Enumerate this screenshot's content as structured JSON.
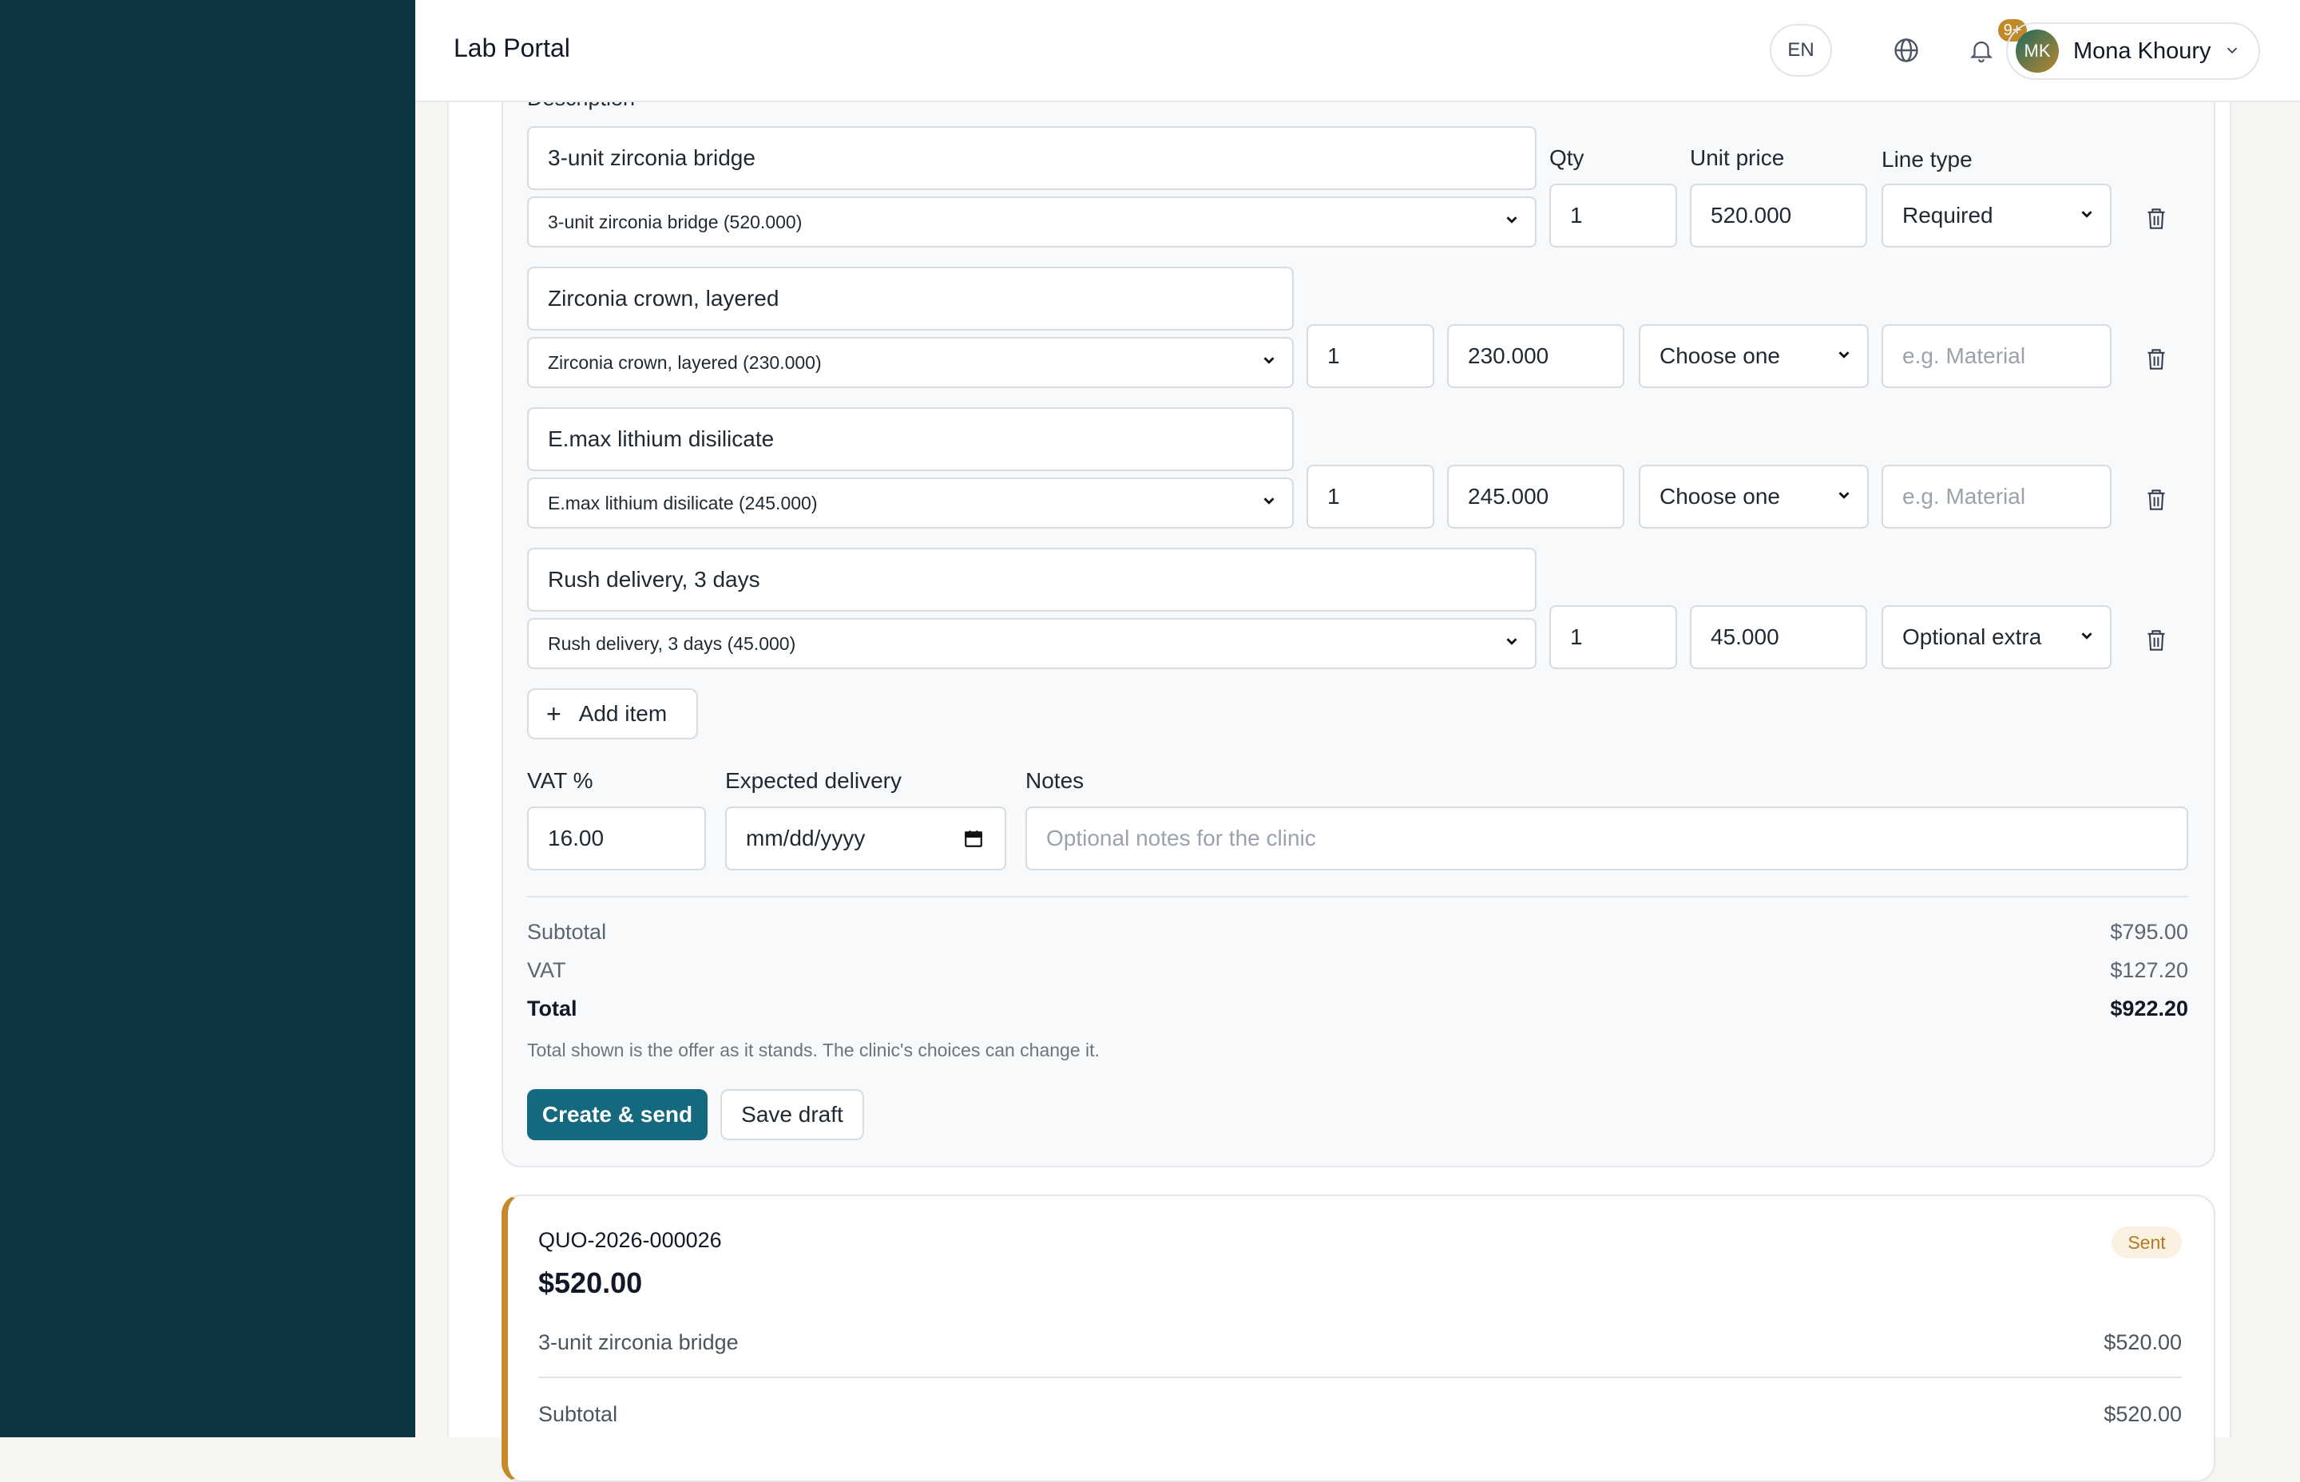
{
  "header": {
    "brand": "Lab Portal",
    "lang": "EN",
    "notif_badge": "9+",
    "user_initials": "MK",
    "user_name": "Mona Khoury"
  },
  "form": {
    "description_label": "Description",
    "qty_label": "Qty",
    "unit_price_label": "Unit price",
    "line_type_label": "Line type",
    "items": [
      {
        "description": "3-unit zirconia bridge",
        "product": "3-unit zirconia bridge (520.000)",
        "qty": "1",
        "unit_price": "520.000",
        "line_type": "Required"
      },
      {
        "description": "Zirconia crown, layered",
        "product": "Zirconia crown, layered (230.000)",
        "qty": "1",
        "unit_price": "230.000",
        "line_type": "Choose one",
        "group_placeholder": "e.g. Material"
      },
      {
        "description": "E.max lithium disilicate",
        "product": "E.max lithium disilicate (245.000)",
        "qty": "1",
        "unit_price": "245.000",
        "line_type": "Choose one",
        "group_placeholder": "e.g. Material"
      },
      {
        "description": "Rush delivery, 3 days",
        "product": "Rush delivery, 3 days (45.000)",
        "qty": "1",
        "unit_price": "45.000",
        "line_type": "Optional extra"
      }
    ],
    "add_item": "Add item",
    "vat_label": "VAT %",
    "vat_value": "16.00",
    "delivery_label": "Expected delivery",
    "delivery_placeholder": "mm/dd/yyyy",
    "notes_label": "Notes",
    "notes_placeholder": "Optional notes for the clinic",
    "subtotal_label": "Subtotal",
    "subtotal_value": "$795.00",
    "vat_total_label": "VAT",
    "vat_total_value": "$127.20",
    "total_label": "Total",
    "total_value": "$922.20",
    "note": "Total shown is the offer as it stands. The clinic's choices can change it.",
    "create_send": "Create & send",
    "save_draft": "Save draft"
  },
  "quote": {
    "id": "QUO-2026-000026",
    "amount": "$520.00",
    "status": "Sent",
    "line_desc": "3-unit zirconia bridge",
    "line_amount": "$520.00",
    "subtotal_label": "Subtotal",
    "subtotal_value": "$520.00"
  },
  "colors": {
    "sidebar": "#0b3540",
    "primary": "#15697e",
    "accent": "#c48a2c"
  }
}
